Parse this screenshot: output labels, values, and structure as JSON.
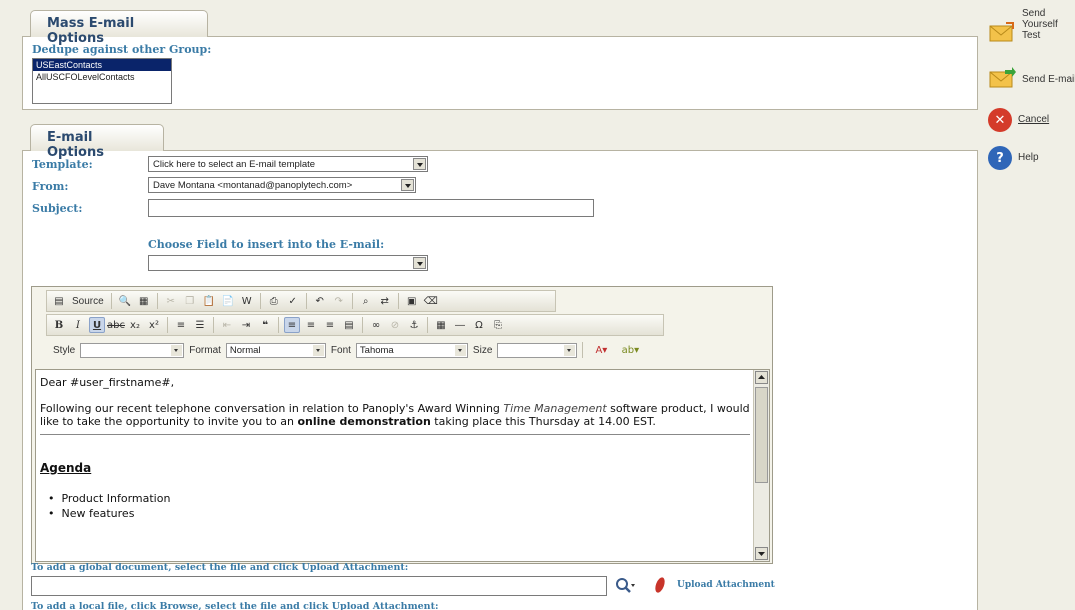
{
  "mass_options": {
    "tab_label": "Mass E-mail Options",
    "dedupe_label": "Dedupe against other Group:",
    "groups": [
      "USEastContacts",
      "AllUSCFOLevelContacts"
    ]
  },
  "email_options": {
    "tab_label": "E-mail Options",
    "template_label": "Template:",
    "template_value": "Click here to select an E-mail template",
    "from_label": "From:",
    "from_value": "Dave Montana <montanad@panoplytech.com>",
    "subject_label": "Subject:",
    "subject_value": "",
    "choose_field_label": "Choose Field to insert into the E-mail:",
    "choose_field_value": ""
  },
  "toolbar": {
    "source_label": "Source",
    "style_label": "Style",
    "style_value": "",
    "format_label": "Format",
    "format_value": "Normal",
    "font_label": "Font",
    "font_value": "Tahoma",
    "size_label": "Size",
    "size_value": ""
  },
  "body": {
    "greeting": "Dear #user_firstname#,",
    "p1_a": "Following our recent telephone conversation in relation to Panoply's Award Winning ",
    "p1_italic": "Time Management",
    "p1_b": " software product, I would like to take the opportunity to invite you to an ",
    "p1_bold": "online demonstration",
    "p1_c": " taking place this Thursday at 14.00 EST.",
    "agenda": "Agenda",
    "items": [
      "Product Information",
      "New features"
    ]
  },
  "attachments": {
    "global_label": "To add a global document, select the file and click Upload Attachment:",
    "global_value": "",
    "upload_label": "Upload Attachment",
    "local_label": "To add a local file, click Browse, select the file and click Upload Attachment:"
  },
  "side_actions": {
    "send_test": "Send Yourself Test",
    "send_email": "Send E-mail",
    "cancel": "Cancel",
    "help": "Help"
  },
  "colors": {
    "label_blue": "#3a7ba6",
    "tab_title": "#2b4a6f",
    "selection": "#0a246a",
    "cancel_red": "#d43b2a",
    "help_blue": "#2f66b8"
  }
}
